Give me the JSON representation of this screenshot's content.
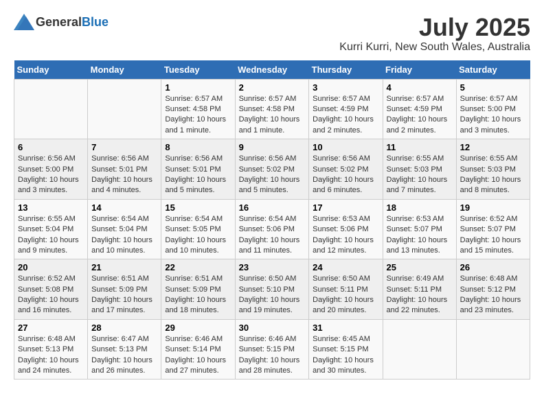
{
  "header": {
    "logo_general": "General",
    "logo_blue": "Blue",
    "month": "July 2025",
    "location": "Kurri Kurri, New South Wales, Australia"
  },
  "weekdays": [
    "Sunday",
    "Monday",
    "Tuesday",
    "Wednesday",
    "Thursday",
    "Friday",
    "Saturday"
  ],
  "weeks": [
    [
      {
        "day": "",
        "content": ""
      },
      {
        "day": "",
        "content": ""
      },
      {
        "day": "1",
        "content": "Sunrise: 6:57 AM\nSunset: 4:58 PM\nDaylight: 10 hours and 1 minute."
      },
      {
        "day": "2",
        "content": "Sunrise: 6:57 AM\nSunset: 4:58 PM\nDaylight: 10 hours and 1 minute."
      },
      {
        "day": "3",
        "content": "Sunrise: 6:57 AM\nSunset: 4:59 PM\nDaylight: 10 hours and 2 minutes."
      },
      {
        "day": "4",
        "content": "Sunrise: 6:57 AM\nSunset: 4:59 PM\nDaylight: 10 hours and 2 minutes."
      },
      {
        "day": "5",
        "content": "Sunrise: 6:57 AM\nSunset: 5:00 PM\nDaylight: 10 hours and 3 minutes."
      }
    ],
    [
      {
        "day": "6",
        "content": "Sunrise: 6:56 AM\nSunset: 5:00 PM\nDaylight: 10 hours and 3 minutes."
      },
      {
        "day": "7",
        "content": "Sunrise: 6:56 AM\nSunset: 5:01 PM\nDaylight: 10 hours and 4 minutes."
      },
      {
        "day": "8",
        "content": "Sunrise: 6:56 AM\nSunset: 5:01 PM\nDaylight: 10 hours and 5 minutes."
      },
      {
        "day": "9",
        "content": "Sunrise: 6:56 AM\nSunset: 5:02 PM\nDaylight: 10 hours and 5 minutes."
      },
      {
        "day": "10",
        "content": "Sunrise: 6:56 AM\nSunset: 5:02 PM\nDaylight: 10 hours and 6 minutes."
      },
      {
        "day": "11",
        "content": "Sunrise: 6:55 AM\nSunset: 5:03 PM\nDaylight: 10 hours and 7 minutes."
      },
      {
        "day": "12",
        "content": "Sunrise: 6:55 AM\nSunset: 5:03 PM\nDaylight: 10 hours and 8 minutes."
      }
    ],
    [
      {
        "day": "13",
        "content": "Sunrise: 6:55 AM\nSunset: 5:04 PM\nDaylight: 10 hours and 9 minutes."
      },
      {
        "day": "14",
        "content": "Sunrise: 6:54 AM\nSunset: 5:04 PM\nDaylight: 10 hours and 10 minutes."
      },
      {
        "day": "15",
        "content": "Sunrise: 6:54 AM\nSunset: 5:05 PM\nDaylight: 10 hours and 10 minutes."
      },
      {
        "day": "16",
        "content": "Sunrise: 6:54 AM\nSunset: 5:06 PM\nDaylight: 10 hours and 11 minutes."
      },
      {
        "day": "17",
        "content": "Sunrise: 6:53 AM\nSunset: 5:06 PM\nDaylight: 10 hours and 12 minutes."
      },
      {
        "day": "18",
        "content": "Sunrise: 6:53 AM\nSunset: 5:07 PM\nDaylight: 10 hours and 13 minutes."
      },
      {
        "day": "19",
        "content": "Sunrise: 6:52 AM\nSunset: 5:07 PM\nDaylight: 10 hours and 15 minutes."
      }
    ],
    [
      {
        "day": "20",
        "content": "Sunrise: 6:52 AM\nSunset: 5:08 PM\nDaylight: 10 hours and 16 minutes."
      },
      {
        "day": "21",
        "content": "Sunrise: 6:51 AM\nSunset: 5:09 PM\nDaylight: 10 hours and 17 minutes."
      },
      {
        "day": "22",
        "content": "Sunrise: 6:51 AM\nSunset: 5:09 PM\nDaylight: 10 hours and 18 minutes."
      },
      {
        "day": "23",
        "content": "Sunrise: 6:50 AM\nSunset: 5:10 PM\nDaylight: 10 hours and 19 minutes."
      },
      {
        "day": "24",
        "content": "Sunrise: 6:50 AM\nSunset: 5:11 PM\nDaylight: 10 hours and 20 minutes."
      },
      {
        "day": "25",
        "content": "Sunrise: 6:49 AM\nSunset: 5:11 PM\nDaylight: 10 hours and 22 minutes."
      },
      {
        "day": "26",
        "content": "Sunrise: 6:48 AM\nSunset: 5:12 PM\nDaylight: 10 hours and 23 minutes."
      }
    ],
    [
      {
        "day": "27",
        "content": "Sunrise: 6:48 AM\nSunset: 5:13 PM\nDaylight: 10 hours and 24 minutes."
      },
      {
        "day": "28",
        "content": "Sunrise: 6:47 AM\nSunset: 5:13 PM\nDaylight: 10 hours and 26 minutes."
      },
      {
        "day": "29",
        "content": "Sunrise: 6:46 AM\nSunset: 5:14 PM\nDaylight: 10 hours and 27 minutes."
      },
      {
        "day": "30",
        "content": "Sunrise: 6:46 AM\nSunset: 5:15 PM\nDaylight: 10 hours and 28 minutes."
      },
      {
        "day": "31",
        "content": "Sunrise: 6:45 AM\nSunset: 5:15 PM\nDaylight: 10 hours and 30 minutes."
      },
      {
        "day": "",
        "content": ""
      },
      {
        "day": "",
        "content": ""
      }
    ]
  ]
}
